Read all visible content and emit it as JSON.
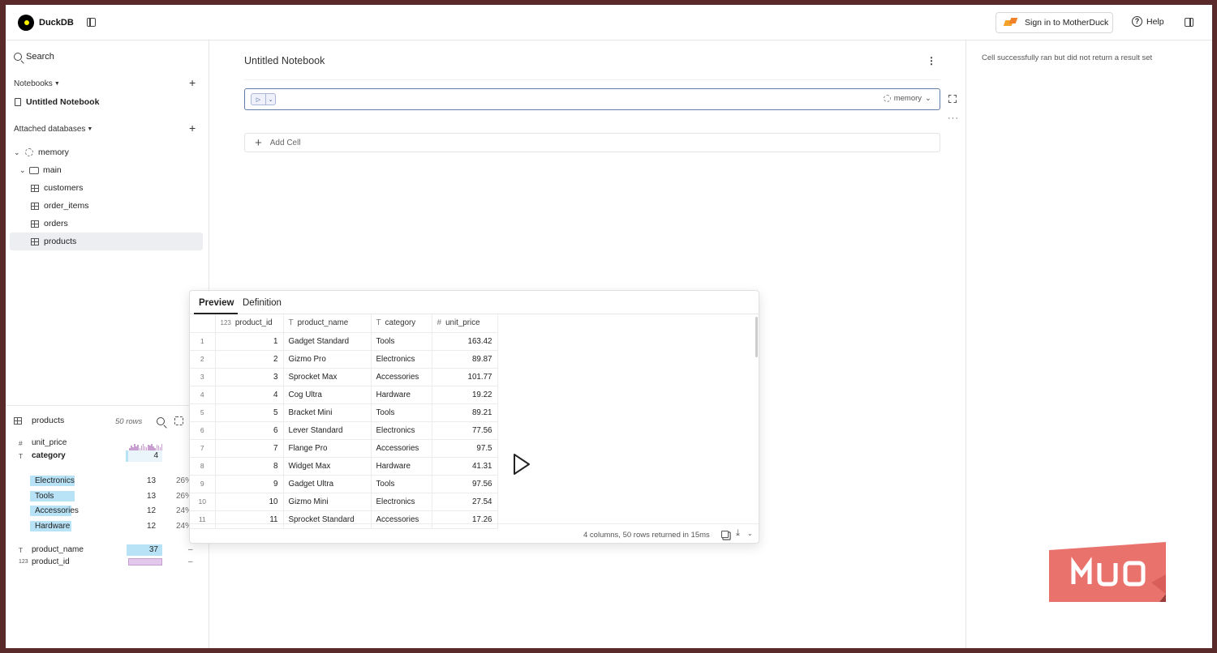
{
  "header": {
    "brand": "DuckDB",
    "signin_label": "Sign in to MotherDuck",
    "help_label": "Help"
  },
  "sidebar": {
    "search_label": "Search",
    "notebooks_label": "Notebooks",
    "notebook_item": "Untitled Notebook",
    "attached_label": "Attached databases",
    "database": "memory",
    "schema": "main",
    "tables": [
      "customers",
      "order_items",
      "orders",
      "products"
    ],
    "selected_table": "products"
  },
  "column_summary": {
    "table": "products",
    "row_count": "50 rows",
    "columns": [
      {
        "type": "#",
        "name": "unit_price"
      },
      {
        "type": "T",
        "name": "category",
        "distinct": "4"
      },
      {
        "type": "T",
        "name": "product_name",
        "distinct": "37"
      },
      {
        "type": "123",
        "name": "product_id"
      }
    ],
    "category_values": [
      {
        "label": "Electronics",
        "count": "13",
        "pct": "26%",
        "share": 0.26
      },
      {
        "label": "Tools",
        "count": "13",
        "pct": "26%",
        "share": 0.26
      },
      {
        "label": "Accessories",
        "count": "12",
        "pct": "24%",
        "share": 0.24
      },
      {
        "label": "Hardware",
        "count": "12",
        "pct": "24%",
        "share": 0.24
      }
    ],
    "dash": "–"
  },
  "notebook": {
    "title": "Untitled Notebook",
    "cell_database": "memory",
    "add_cell_label": "Add Cell"
  },
  "right_panel": {
    "message": "Cell successfully ran but did not return a result set"
  },
  "preview": {
    "tabs": [
      "Preview",
      "Definition"
    ],
    "columns": [
      {
        "type": "123",
        "name": "product_id"
      },
      {
        "type": "T",
        "name": "product_name"
      },
      {
        "type": "T",
        "name": "category"
      },
      {
        "type": "#",
        "name": "unit_price"
      }
    ],
    "rows": [
      [
        "1",
        "1",
        "Gadget Standard",
        "Tools",
        "163.42"
      ],
      [
        "2",
        "2",
        "Gizmo Pro",
        "Electronics",
        "89.87"
      ],
      [
        "3",
        "3",
        "Sprocket Max",
        "Accessories",
        "101.77"
      ],
      [
        "4",
        "4",
        "Cog Ultra",
        "Hardware",
        "19.22"
      ],
      [
        "5",
        "5",
        "Bracket Mini",
        "Tools",
        "89.21"
      ],
      [
        "6",
        "6",
        "Lever Standard",
        "Electronics",
        "77.56"
      ],
      [
        "7",
        "7",
        "Flange Pro",
        "Accessories",
        "97.5"
      ],
      [
        "8",
        "8",
        "Widget Max",
        "Hardware",
        "41.31"
      ],
      [
        "9",
        "9",
        "Gadget Ultra",
        "Tools",
        "97.56"
      ],
      [
        "10",
        "10",
        "Gizmo Mini",
        "Electronics",
        "27.54"
      ],
      [
        "11",
        "11",
        "Sprocket Standard",
        "Accessories",
        "17.26"
      ]
    ],
    "footer": "4 columns, 50 rows returned in 15ms"
  },
  "watermark": "MUO",
  "colors": {
    "bar_blue": "#b8e2f5",
    "hist_purple": "#c89dd0",
    "cell_border": "#5f7fa8",
    "watermark": "#e9726d",
    "frame": "#5a2a2a"
  }
}
